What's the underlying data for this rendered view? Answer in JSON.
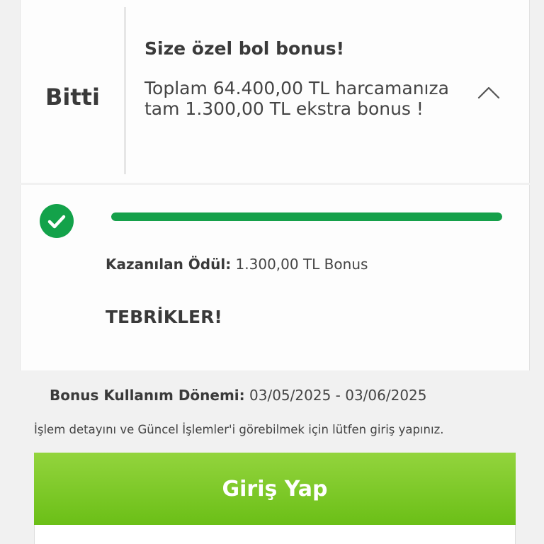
{
  "campaign": {
    "status": "Bitti",
    "title": "Size özel bol bonus!",
    "description": "Toplam 64.400,00 TL harcamanıza tam 1.300,00 TL ekstra bonus !",
    "chevron_icon": "chevron-up-icon"
  },
  "progress": {
    "check_icon": "check-circle-icon",
    "fraction": 1.0,
    "color": "#15a04a",
    "reward_label": "Kazanılan Ödül:",
    "reward_value": "1.300,00 TL Bonus",
    "congrats": "TEBRİKLER!"
  },
  "bonus_period": {
    "label": "Bonus Kullanım Dönemi:",
    "value": "03/05/2025 - 03/06/2025"
  },
  "login": {
    "info_text": "İşlem detayını ve Güncel İşlemler'i görebilmek için lütfen giriş yapınız.",
    "button_label": "Giriş Yap",
    "button_color": "#7cc62a"
  }
}
